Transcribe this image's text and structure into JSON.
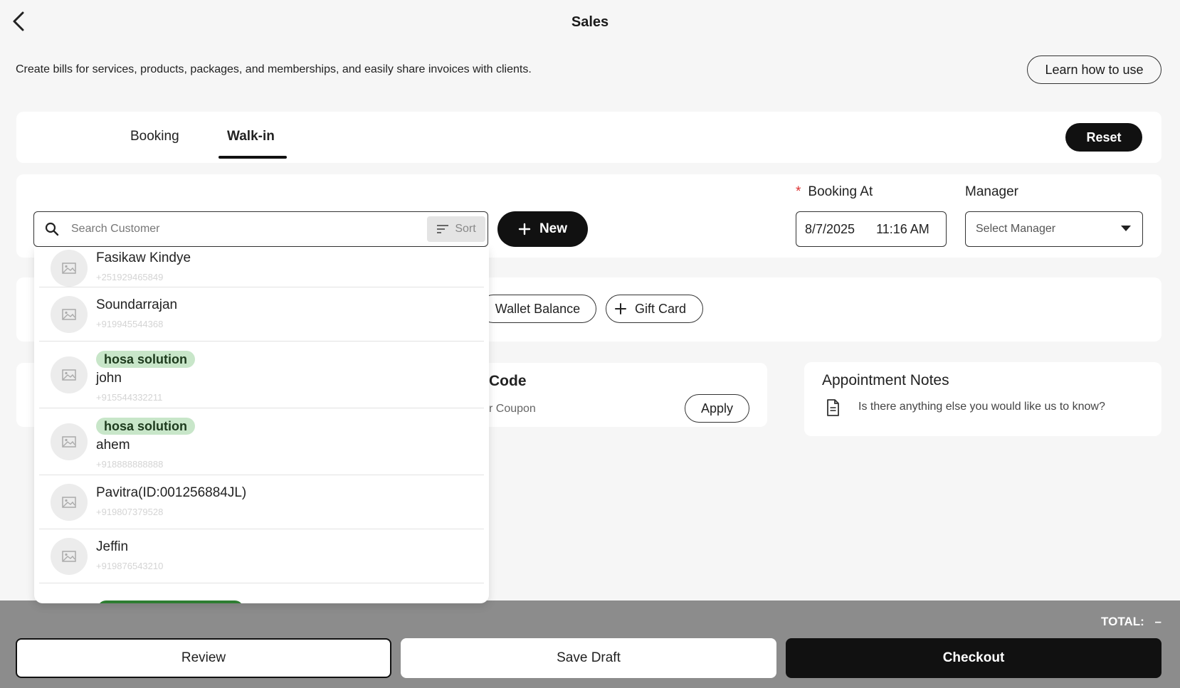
{
  "header": {
    "title": "Sales",
    "back_icon": "chevron-left-icon"
  },
  "intro": {
    "description": "Create bills for services, products, packages, and memberships, and easily share invoices with clients.",
    "learn_label": "Learn how to use"
  },
  "tabs": {
    "items": [
      {
        "label": "Booking"
      },
      {
        "label": "Walk-in",
        "active": true
      }
    ],
    "reset_label": "Reset"
  },
  "customer": {
    "search_placeholder": "Search Customer",
    "sort_label": "Sort",
    "new_label": "New"
  },
  "booking": {
    "label": "Booking At",
    "required_mark": "*",
    "date": "8/7/2025",
    "time": "11:16 AM"
  },
  "manager": {
    "label": "Manager",
    "placeholder": "Select Manager"
  },
  "wallet": {
    "balance_label": "Wallet Balance",
    "gift_card_label": "Gift Card"
  },
  "promo": {
    "title": "Code",
    "placeholder": "r Coupon",
    "apply_label": "Apply"
  },
  "notes": {
    "title": "Appointment Notes",
    "placeholder": "Is there anything else you would like us to know?"
  },
  "customer_list": [
    {
      "name": "Fasikaw Kindye",
      "phone": "+251929465849",
      "tag": ""
    },
    {
      "name": "Soundarrajan",
      "phone": "+919945544368",
      "tag": ""
    },
    {
      "name": "john",
      "phone": "+915544332211",
      "tag": "hosa solution"
    },
    {
      "name": "ahem",
      "phone": "+918888888888",
      "tag": "hosa solution"
    },
    {
      "name": "Pavitra(ID:001256884JL)",
      "phone": "+919807379528",
      "tag": ""
    },
    {
      "name": "Jeffin",
      "phone": "+919876543210",
      "tag": ""
    }
  ],
  "footer": {
    "total_label": "TOTAL:",
    "total_value": "–",
    "review_label": "Review",
    "save_draft_label": "Save Draft",
    "checkout_label": "Checkout"
  },
  "colors": {
    "accent": "#111111",
    "tag_bg": "#c8e6c9",
    "overlay": "#8c8c8c"
  }
}
